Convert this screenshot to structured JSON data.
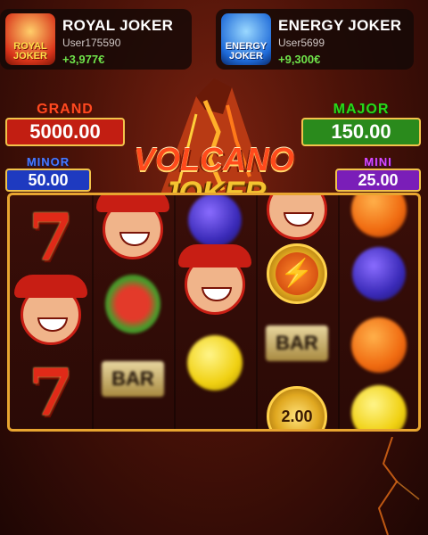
{
  "recent_wins": [
    {
      "game": "ROYAL JOKER",
      "logo": "ROYAL JOKER",
      "user": "User175590",
      "amount": "+3,977€"
    },
    {
      "game": "ENERGY JOKER",
      "logo": "ENERGY JOKER",
      "user": "User5699",
      "amount": "+9,300€"
    }
  ],
  "jackpots": {
    "grand": {
      "label": "GRAND",
      "value": "5000.00"
    },
    "major": {
      "label": "MAJOR",
      "value": "150.00"
    },
    "minor": {
      "label": "MINOR",
      "value": "50.00"
    },
    "mini": {
      "label": "MINI",
      "value": "25.00"
    }
  },
  "game_title": {
    "line1": "VOLCANO",
    "line2": "JOKER"
  },
  "reels": {
    "coin_value": "2.00",
    "symbols": [
      [
        "seven",
        "joker",
        "seven"
      ],
      [
        "joker",
        "melon",
        "bar"
      ],
      [
        "plum",
        "joker",
        "lemon"
      ],
      [
        "joker",
        "coin-bolt",
        "bar",
        "coin-2.00"
      ],
      [
        "orange",
        "plum",
        "orange",
        "lemon"
      ]
    ],
    "bar_label": "BAR"
  },
  "colors": {
    "win_amount": "#6fe34a",
    "grand": "#c21e12",
    "major": "#2a8a1c",
    "minor": "#1e3ac0",
    "mini": "#7a1eb8",
    "frame": "#e8a530"
  }
}
